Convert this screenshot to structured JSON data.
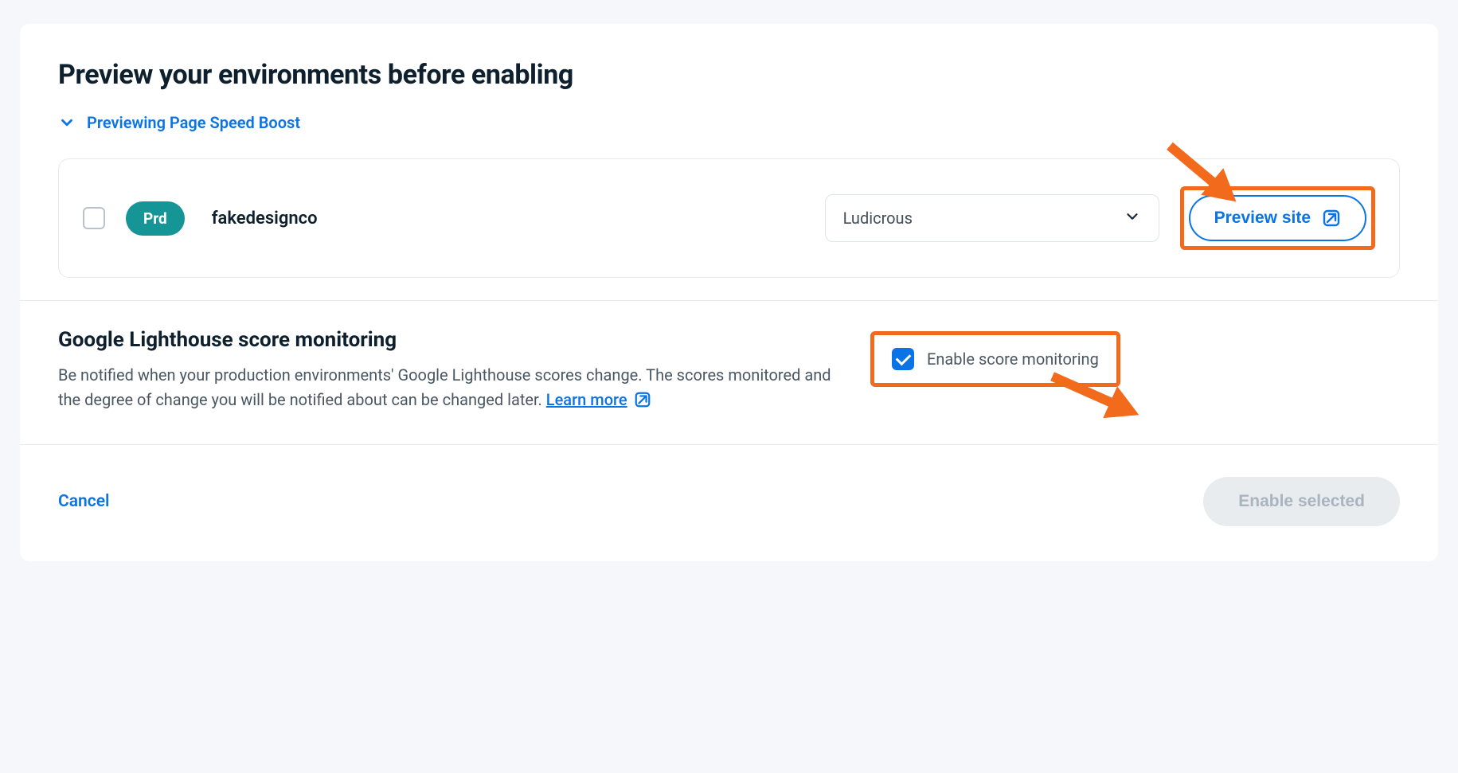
{
  "header": {
    "title": "Preview your environments before enabling",
    "disclosure_label": "Previewing Page Speed Boost"
  },
  "env_row": {
    "badge": "Prd",
    "name": "fakedesignco",
    "selected_option": "Ludicrous",
    "preview_button": "Preview site"
  },
  "monitoring": {
    "title": "Google Lighthouse score monitoring",
    "description": "Be notified when your production environments' Google Lighthouse scores change. The scores monitored and  the degree of change you will be notified about can be changed later.  ",
    "learn_more": "Learn more",
    "toggle_label": "Enable score monitoring"
  },
  "footer": {
    "cancel": "Cancel",
    "enable": "Enable selected"
  },
  "colors": {
    "accent": "#0a74e6",
    "highlight": "#f26a1b",
    "badge": "#159595"
  }
}
